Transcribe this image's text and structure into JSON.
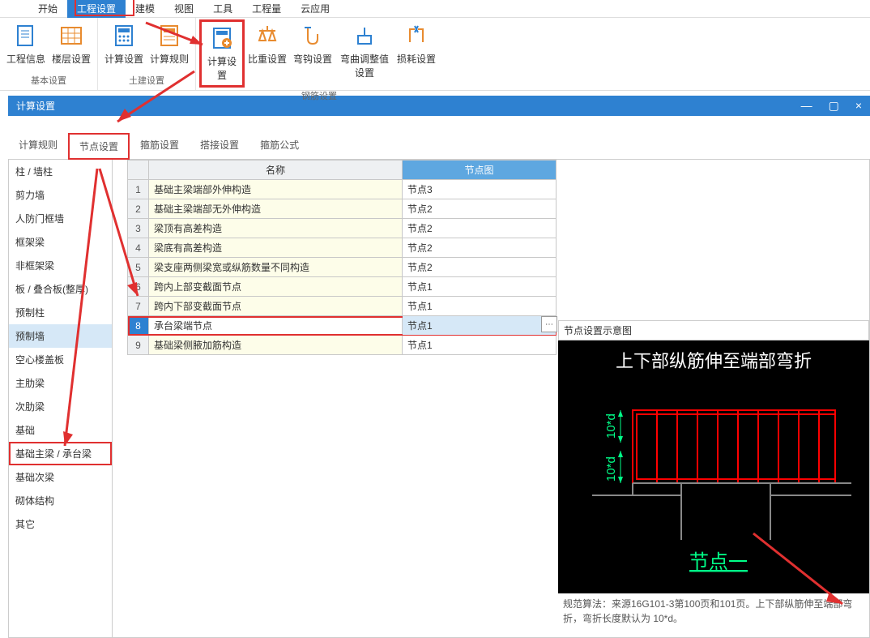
{
  "menubar": {
    "items": [
      "开始",
      "工程设置",
      "建模",
      "视图",
      "工具",
      "工程量",
      "云应用"
    ],
    "active_index": 1
  },
  "ribbon": {
    "groups": [
      {
        "title": "基本设置",
        "buttons": [
          {
            "label": "工程信息",
            "icon": "doc-blue"
          },
          {
            "label": "楼层设置",
            "icon": "grid-orange"
          }
        ]
      },
      {
        "title": "土建设置",
        "buttons": [
          {
            "label": "计算设置",
            "icon": "calc-blue"
          },
          {
            "label": "计算规则",
            "icon": "rule-orange"
          }
        ]
      },
      {
        "title": "钢筋设置",
        "buttons": [
          {
            "label": "计算设置",
            "icon": "calc-plus",
            "highlighted": true
          },
          {
            "label": "比重设置",
            "icon": "weight"
          },
          {
            "label": "弯钩设置",
            "icon": "hook"
          },
          {
            "label": "弯曲调整值设置",
            "icon": "bend"
          },
          {
            "label": "损耗设置",
            "icon": "loss"
          }
        ]
      }
    ]
  },
  "panel": {
    "title": "计算设置",
    "controls": {
      "min": "—",
      "max": "▢",
      "close": "×"
    }
  },
  "subtabs": {
    "items": [
      "计算规则",
      "节点设置",
      "箍筋设置",
      "搭接设置",
      "箍筋公式"
    ],
    "active_index": 1
  },
  "sidebar": {
    "items": [
      "柱 / 墙柱",
      "剪力墙",
      "人防门框墙",
      "框架梁",
      "非框架梁",
      "板 / 叠合板(整厚)",
      "预制柱",
      "预制墙",
      "空心楼盖板",
      "主肋梁",
      "次肋梁",
      "基础",
      "基础主梁 / 承台梁",
      "基础次梁",
      "砌体结构",
      "其它"
    ],
    "selected_index": 7,
    "highlighted_index": 12
  },
  "table": {
    "headers": {
      "name": "名称",
      "node": "节点图"
    },
    "rows": [
      {
        "num": "1",
        "name": "基础主梁端部外伸构造",
        "node": "节点3"
      },
      {
        "num": "2",
        "name": "基础主梁端部无外伸构造",
        "node": "节点2"
      },
      {
        "num": "3",
        "name": "梁顶有高差构造",
        "node": "节点2"
      },
      {
        "num": "4",
        "name": "梁底有高差构造",
        "node": "节点2"
      },
      {
        "num": "5",
        "name": "梁支座两侧梁宽或纵筋数量不同构造",
        "node": "节点2"
      },
      {
        "num": "6",
        "name": "跨内上部变截面节点",
        "node": "节点1"
      },
      {
        "num": "7",
        "name": "跨内下部变截面节点",
        "node": "节点1"
      },
      {
        "num": "8",
        "name": "承台梁端节点",
        "node": "节点1",
        "selected": true,
        "highlighted": true
      },
      {
        "num": "9",
        "name": "基础梁侧腋加筋构造",
        "node": "节点1"
      }
    ],
    "expand_icon": "⋯"
  },
  "diagram": {
    "panel_title": "节点设置示意图",
    "heading": "上下部纵筋伸至端部弯折",
    "dim_label_1": "10*d",
    "dim_label_2": "10*d",
    "node_label": "节点一",
    "footnote": "规范算法：来源16G101-3第100页和101页。上下部纵筋伸至端部弯折，弯折长度默认为 10*d。"
  }
}
